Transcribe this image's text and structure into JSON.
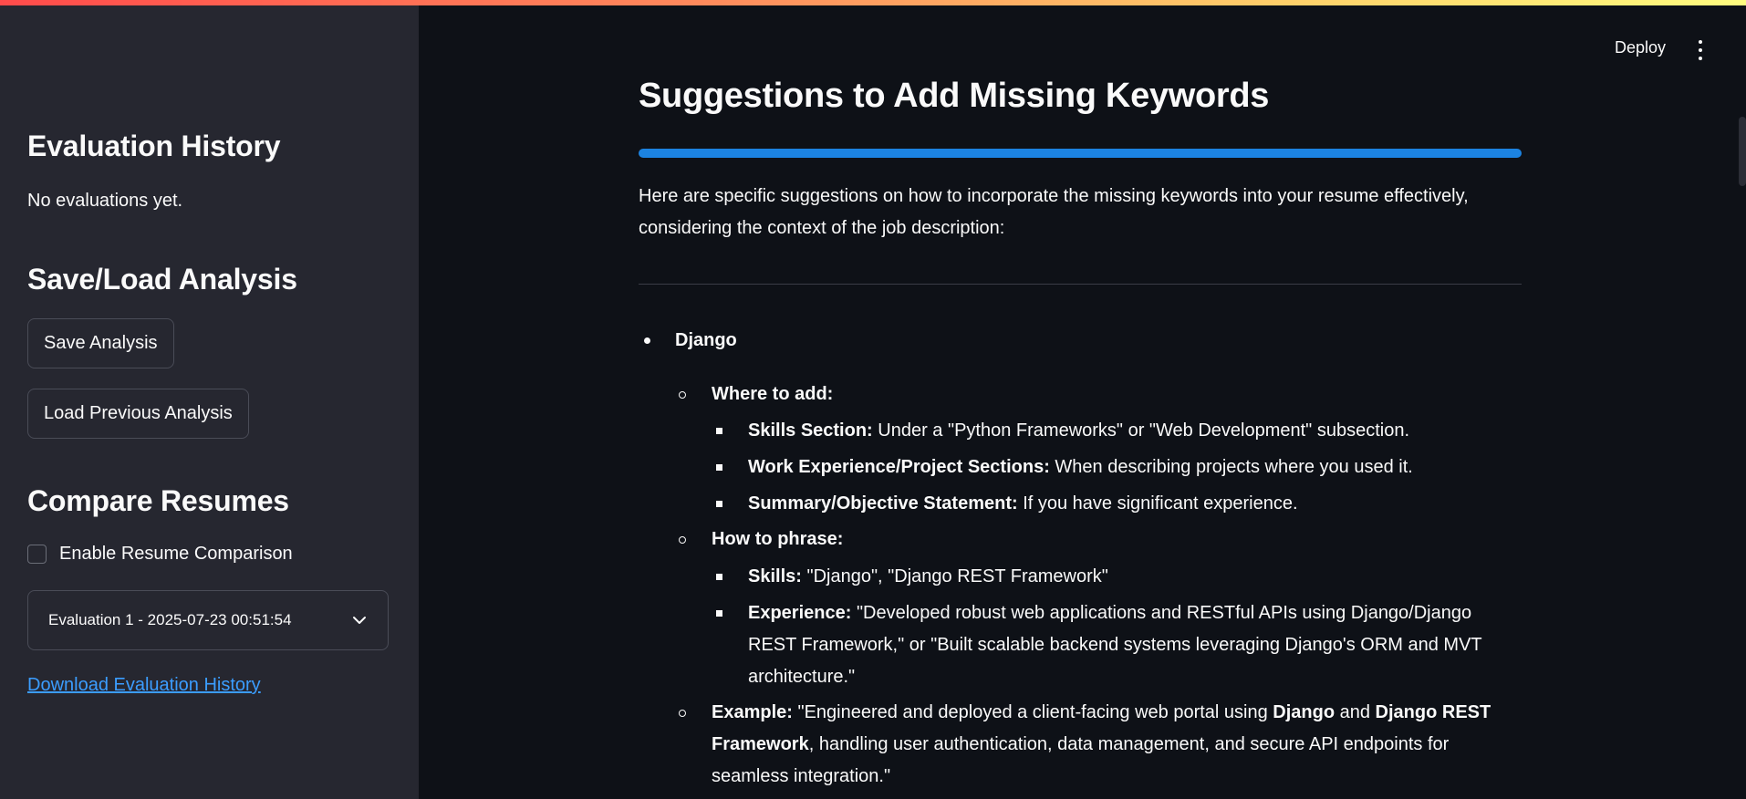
{
  "sidebar": {
    "history_title": "Evaluation History",
    "history_empty": "No evaluations yet.",
    "saveload_title": "Save/Load Analysis",
    "save_button": "Save Analysis",
    "load_button": "Load Previous Analysis",
    "compare_title": "Compare Resumes",
    "compare_checkbox_label": "Enable Resume Comparison",
    "compare_checkbox_checked": false,
    "select_value": "Evaluation 1 - 2025-07-23 00:51:54",
    "download_link": "Download Evaluation History"
  },
  "header": {
    "deploy_label": "Deploy",
    "menu_icon": "kebab-menu-icon"
  },
  "main": {
    "title": "Suggestions to Add Missing Keywords",
    "intro_line1": "Here are specific suggestions on how to incorporate the missing keywords into your resume effectively,",
    "intro_line2": "considering the context of the job description:",
    "keyword": "Django",
    "where_label": "Where to add:",
    "where_items": [
      {
        "bold": "Skills Section:",
        "text": " Under a \"Python Frameworks\" or \"Web Development\" subsection."
      },
      {
        "bold": "Work Experience/Project Sections:",
        "text": " When describing projects where you used it."
      },
      {
        "bold": "Summary/Objective Statement:",
        "text": " If you have significant experience."
      }
    ],
    "phrase_label": "How to phrase:",
    "phrase_items": [
      {
        "bold": "Skills:",
        "text": " \"Django\", \"Django REST Framework\""
      },
      {
        "bold": "Experience:",
        "text": " \"Developed robust web applications and RESTful APIs using Django/Django",
        "line2": "REST Framework,\" or \"Built scalable backend systems leveraging Django's ORM and MVT",
        "line3": "architecture.\""
      }
    ],
    "example_label": "Example:",
    "example_pre": " \"Engineered and deployed a client-facing web portal using ",
    "example_b1": "Django",
    "example_mid": " and ",
    "example_b2": "Django REST",
    "example_line2_b": "Framework",
    "example_line2": ", handling user authentication, data management, and secure API endpoints for",
    "example_line3": "seamless integration.\""
  },
  "colors": {
    "accent": "#1c83e1",
    "link": "#3b9dff",
    "sidebar_bg": "#262730",
    "main_bg": "#0e1117"
  }
}
